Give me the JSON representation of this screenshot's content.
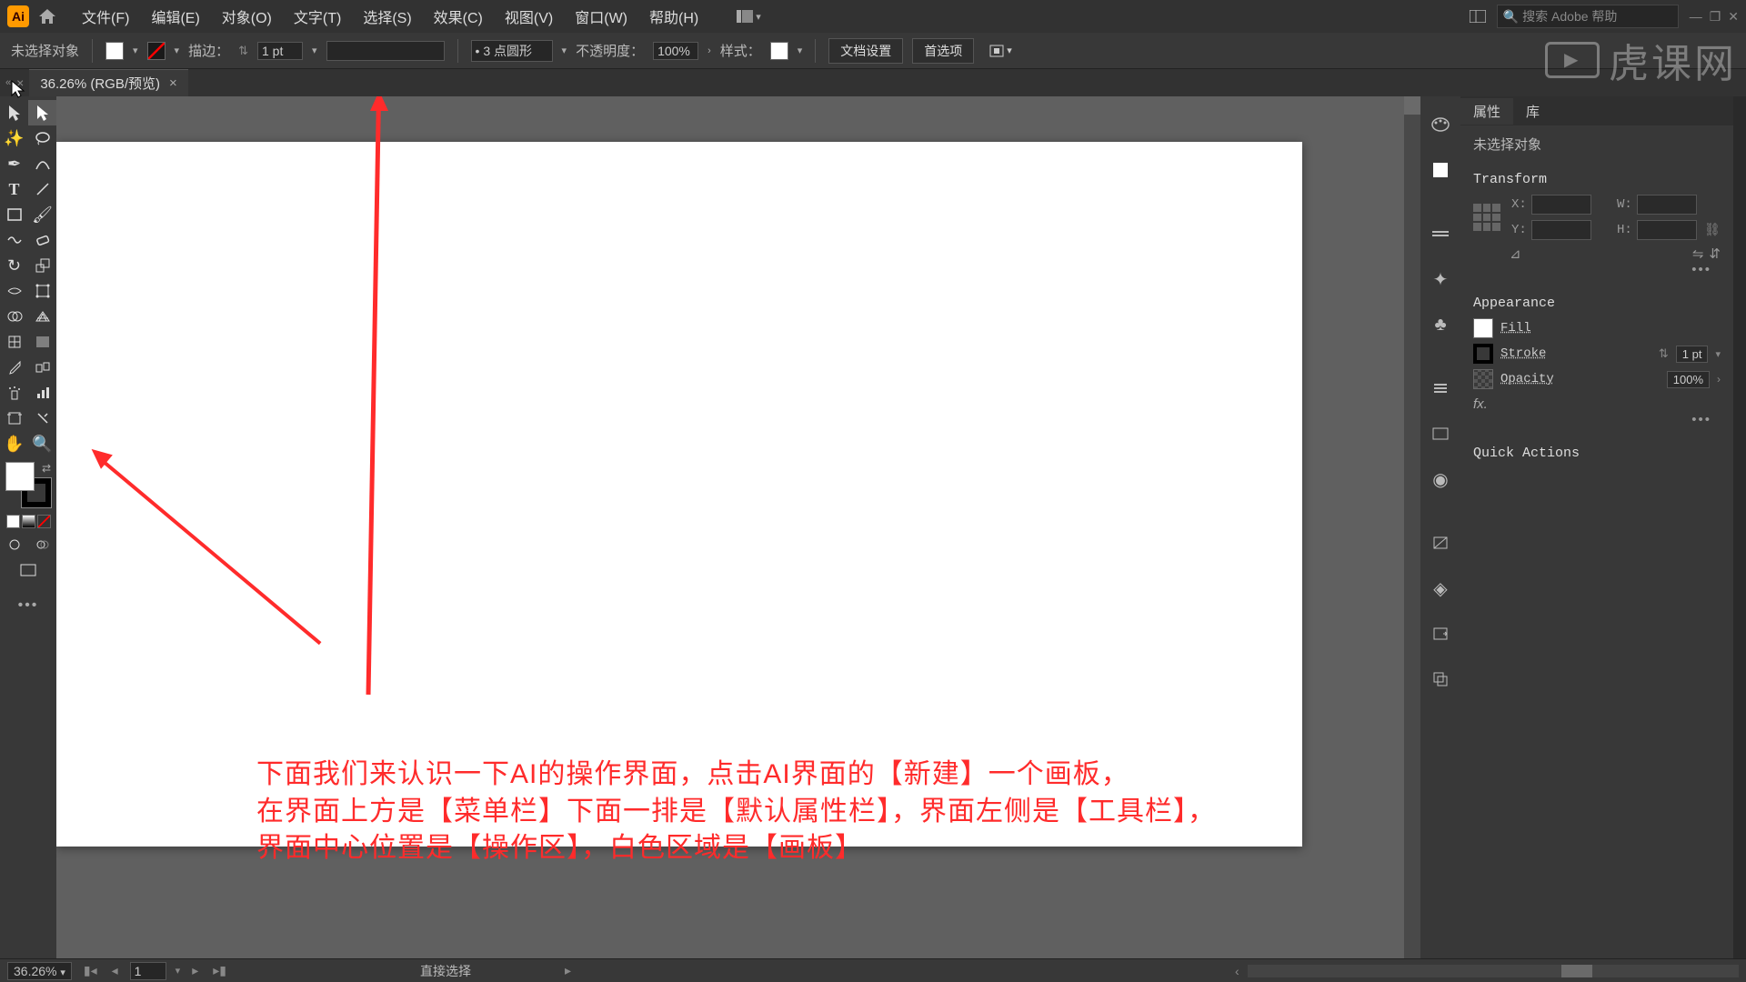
{
  "menubar": {
    "app": "Ai",
    "items": [
      "文件(F)",
      "编辑(E)",
      "对象(O)",
      "文字(T)",
      "选择(S)",
      "效果(C)",
      "视图(V)",
      "窗口(W)",
      "帮助(H)"
    ],
    "search_placeholder": "搜索 Adobe 帮助"
  },
  "controlbar": {
    "no_selection": "未选择对象",
    "stroke_label": "描边：",
    "stroke_val": "1 pt",
    "brush_val": "3 点圆形",
    "opacity_label": "不透明度：",
    "opacity_val": "100%",
    "style_label": "样式：",
    "doc_setup": "文档设置",
    "prefs": "首选项"
  },
  "tabbar": {
    "doc": "36.26% (RGB/预览)"
  },
  "annotation": {
    "line1": "下面我们来认识一下AI的操作界面，点击AI界面的【新建】一个画板，",
    "line2": "在界面上方是【菜单栏】下面一排是【默认属性栏】，界面左侧是【工具栏】，",
    "line3": "界面中心位置是【操作区】，白色区域是【画板】"
  },
  "props": {
    "tabs": [
      "属性",
      "库"
    ],
    "no_sel": "未选择对象",
    "transform": "Transform",
    "x": "X:",
    "y": "Y:",
    "w": "W:",
    "h": "H:",
    "appearance": "Appearance",
    "fill": "Fill",
    "stroke": "Stroke",
    "stroke_val": "1 pt",
    "opacity": "Opacity",
    "opacity_val": "100%",
    "fx": "fx.",
    "quick": "Quick Actions"
  },
  "statusbar": {
    "zoom": "36.26%",
    "artboard": "1",
    "tool": "直接选择"
  },
  "watermark": "虎课网"
}
